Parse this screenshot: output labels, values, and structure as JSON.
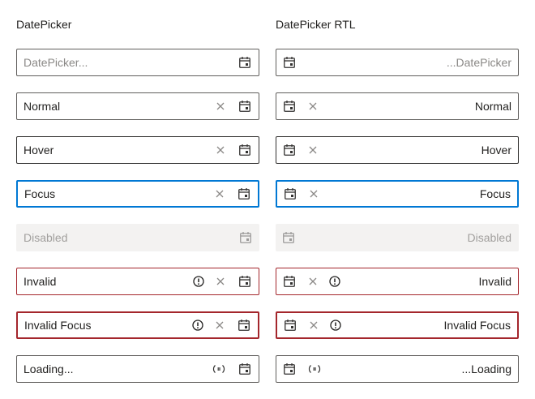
{
  "left": {
    "heading": "DatePicker",
    "fields": [
      {
        "state": "placeholder",
        "text": "DatePicker...",
        "icons": [
          "calendar"
        ]
      },
      {
        "state": "normal",
        "text": "Normal",
        "icons": [
          "clear",
          "calendar"
        ]
      },
      {
        "state": "hover",
        "text": "Hover",
        "icons": [
          "clear",
          "calendar"
        ]
      },
      {
        "state": "focus",
        "text": "Focus",
        "icons": [
          "clear",
          "calendar"
        ]
      },
      {
        "state": "disabled",
        "text": "Disabled",
        "icons": [
          "calendar"
        ]
      },
      {
        "state": "invalid",
        "text": "Invalid",
        "icons": [
          "error",
          "clear",
          "calendar"
        ]
      },
      {
        "state": "invalid-focus",
        "text": "Invalid Focus",
        "icons": [
          "error",
          "clear",
          "calendar"
        ]
      },
      {
        "state": "loading",
        "text": "Loading...",
        "icons": [
          "loading",
          "calendar"
        ]
      }
    ]
  },
  "right": {
    "heading": "DatePicker RTL",
    "fields": [
      {
        "state": "placeholder",
        "text": "...DatePicker",
        "icons": [
          "calendar"
        ]
      },
      {
        "state": "normal",
        "text": "Normal",
        "icons": [
          "calendar",
          "clear"
        ]
      },
      {
        "state": "hover",
        "text": "Hover",
        "icons": [
          "calendar",
          "clear"
        ]
      },
      {
        "state": "focus",
        "text": "Focus",
        "icons": [
          "calendar",
          "clear"
        ]
      },
      {
        "state": "disabled",
        "text": "Disabled",
        "icons": [
          "calendar"
        ]
      },
      {
        "state": "invalid",
        "text": "Invalid",
        "icons": [
          "calendar",
          "clear",
          "error"
        ]
      },
      {
        "state": "invalid-focus",
        "text": "Invalid Focus",
        "icons": [
          "calendar",
          "clear",
          "error"
        ]
      },
      {
        "state": "loading",
        "text": "...Loading",
        "icons": [
          "calendar",
          "loading"
        ]
      }
    ]
  },
  "colors": {
    "border": "#605e5c",
    "focus": "#0078d4",
    "invalid": "#a4262c",
    "disabled_bg": "#f3f2f1",
    "placeholder": "#8a8886"
  }
}
